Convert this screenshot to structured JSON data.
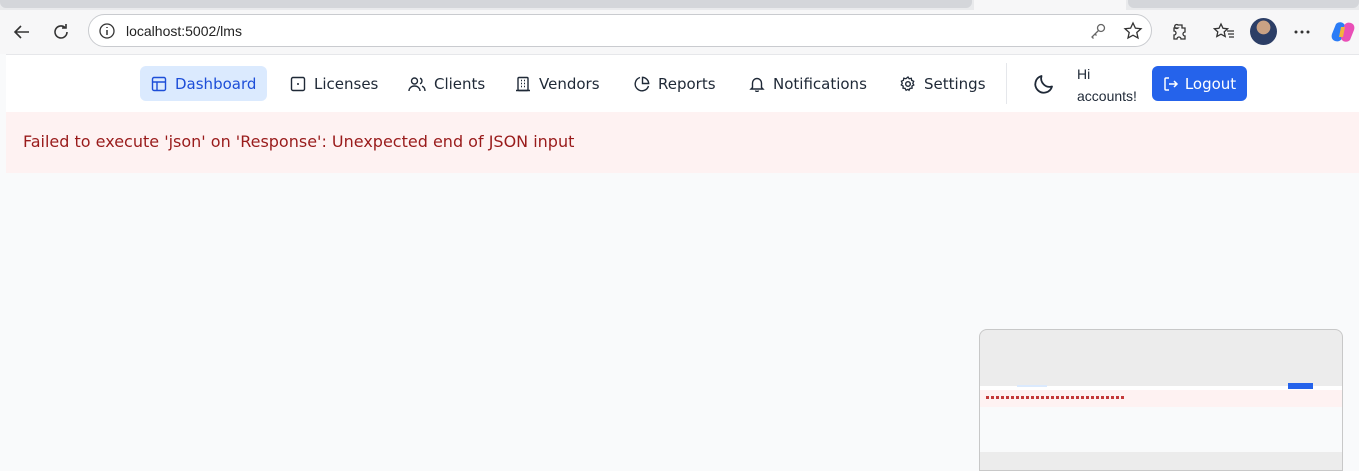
{
  "browser": {
    "url": "localhost:5002/lms",
    "icons": [
      "back-icon",
      "reload-icon",
      "info-icon",
      "key-icon",
      "favorite-star-icon",
      "extensions-icon",
      "favorites-icon",
      "profile-avatar",
      "more-icon",
      "copilot-icon"
    ]
  },
  "nav": {
    "items": [
      {
        "label": "Dashboard",
        "icon": "dashboard-icon",
        "active": true
      },
      {
        "label": "Licenses",
        "icon": "license-icon"
      },
      {
        "label": "Clients",
        "icon": "users-icon"
      },
      {
        "label": "Vendors",
        "icon": "building-icon"
      },
      {
        "label": "Reports",
        "icon": "pie-chart-icon"
      },
      {
        "label": "Notifications",
        "icon": "bell-icon"
      },
      {
        "label": "Settings",
        "icon": "gear-icon"
      }
    ],
    "greeting": "Hi accounts!",
    "logout_label": "Logout"
  },
  "error": {
    "message": "Failed to execute 'json' on 'Response': Unexpected end of JSON input"
  },
  "colors": {
    "accent": "#2563eb",
    "active_bg": "#dbeafe",
    "error_bg": "#fef2f2",
    "error_text": "#991b1b"
  }
}
